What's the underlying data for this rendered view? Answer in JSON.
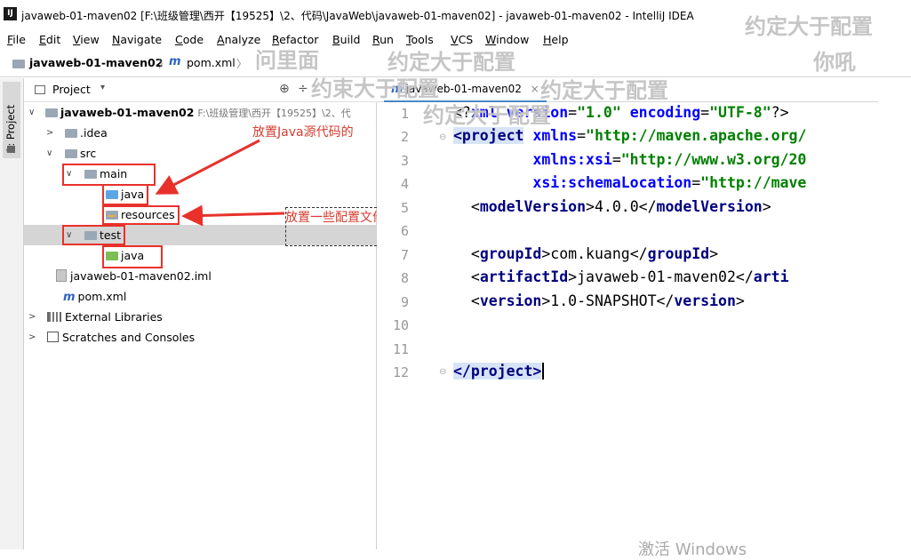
{
  "window": {
    "icon_text": "IJ",
    "title": "javaweb-01-maven02 [F:\\班级管理\\西开【19525】\\2、代码\\JavaWeb\\javaweb-01-maven02] - javaweb-01-maven02 - IntelliJ IDEA"
  },
  "menu": [
    "File",
    "Edit",
    "View",
    "Navigate",
    "Code",
    "Analyze",
    "Refactor",
    "Build",
    "Run",
    "Tools",
    "VCS",
    "Window",
    "Help"
  ],
  "breadcrumb": {
    "project": "javaweb-01-maven02",
    "sep": "〉",
    "file": "pom.xml",
    "end": "〉"
  },
  "toolstrip": {
    "project_tab": "1: Project"
  },
  "project_panel": {
    "header": "Project",
    "header_arrow": "▾",
    "root": {
      "name": "javaweb-01-maven02",
      "path": "F:\\班级管理\\西开【19525】\\2、代"
    },
    "items": {
      "idea": ".idea",
      "src": "src",
      "main": "main",
      "main_java": "java",
      "resources": "resources",
      "test": "test",
      "test_java": "java",
      "iml": "javaweb-01-maven02.iml",
      "pom": "pom.xml",
      "ext_libs": "External Libraries",
      "scratches": "Scratches and Consoles"
    }
  },
  "annotations": {
    "java_source": "放置Java源代码的",
    "config_files": "放置一些配置文件的"
  },
  "editor": {
    "tab_label": "javaweb-01-maven02",
    "tab_close": "×",
    "line_numbers": [
      "1",
      "2",
      "3",
      "4",
      "5",
      "6",
      "7",
      "8",
      "9",
      "10",
      "11",
      "12"
    ],
    "code": {
      "l1_a": "<?",
      "l1_b": "xml version",
      "l1_c": "=",
      "l1_d": "\"1.0\"",
      "l1_e": " encoding",
      "l1_f": "=",
      "l1_g": "\"UTF-8\"",
      "l1_h": "?>",
      "l2_a": "<project",
      "l2_b": " xmlns",
      "l2_c": "=",
      "l2_d": "\"http://maven.apache.org/",
      "l3_a": "         xmlns:xsi",
      "l3_b": "=",
      "l3_c": "\"http://www.w3.org/20",
      "l4_a": "         xsi:schemaLocation",
      "l4_b": "=",
      "l4_c": "\"http://mave",
      "l5_a": "  <",
      "l5_b": "modelVersion",
      "l5_c": ">4.0.0</",
      "l5_d": "modelVersion",
      "l5_e": ">",
      "l7_a": "  <",
      "l7_b": "groupId",
      "l7_c": ">com.kuang</",
      "l7_d": "groupId",
      "l7_e": ">",
      "l8_a": "  <",
      "l8_b": "artifactId",
      "l8_c": ">javaweb-01-maven02</",
      "l8_d": "arti",
      "l9_a": "  <",
      "l9_b": "version",
      "l9_c": ">1.0-SNAPSHOT</",
      "l9_d": "version",
      "l9_e": ">",
      "l12": "</project>"
    }
  },
  "overlay_text": {
    "danmaku": [
      "约定大于配置",
      "你吼",
      "问里面",
      "约定大于配置",
      "约束大于配置",
      "约定大于配置",
      "约定大于配置"
    ],
    "activate": "激活 Windows"
  }
}
